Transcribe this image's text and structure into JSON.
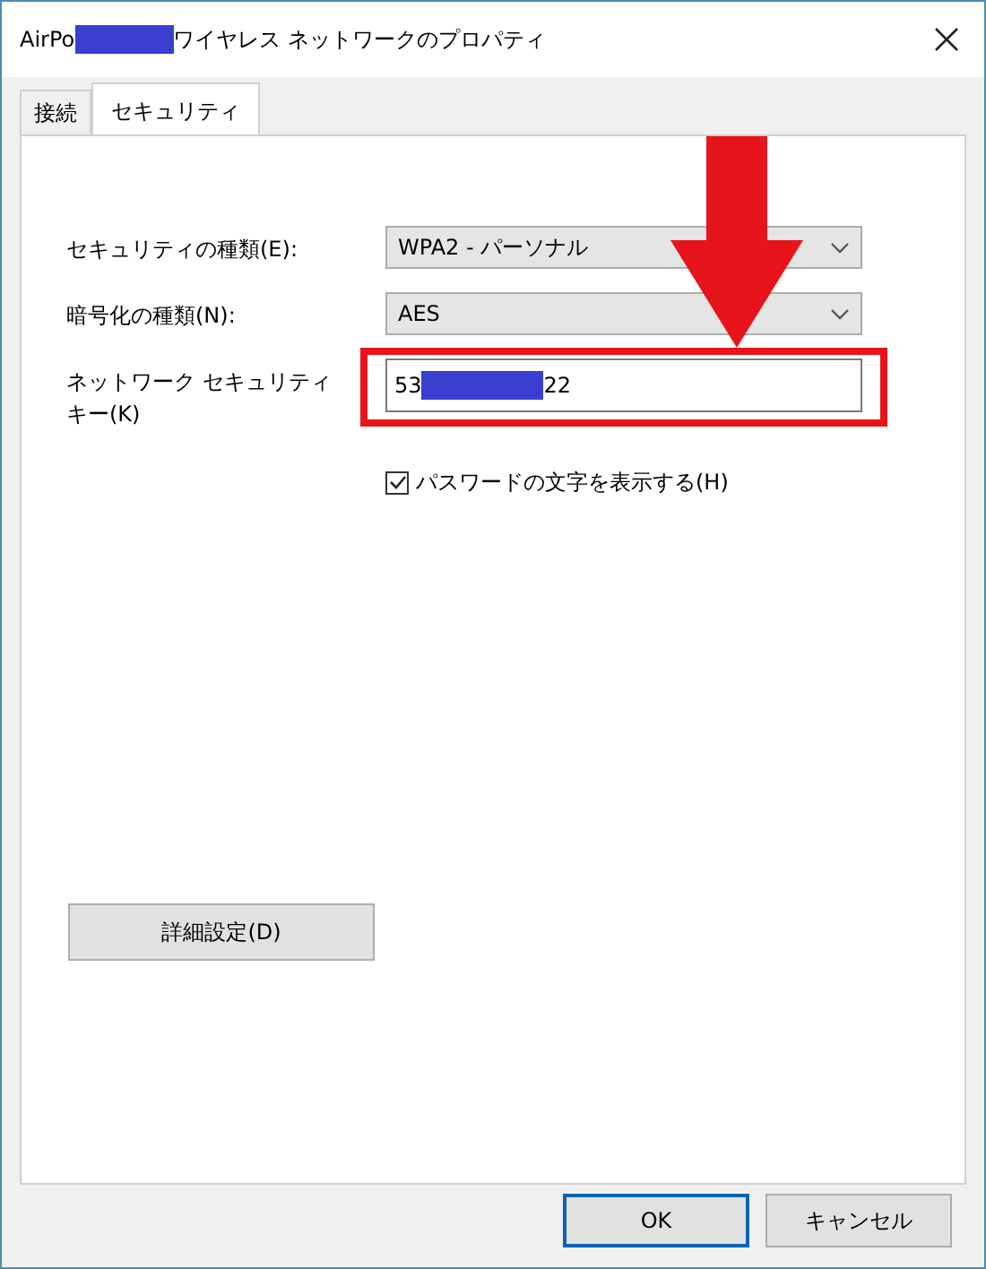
{
  "window": {
    "title_parts": [
      "AirPo",
      "ワイヤレス ネットワークのプロパティ"
    ],
    "title_redacted": true
  },
  "tabs": [
    {
      "label": "接続",
      "selected": false
    },
    {
      "label": "セキュリティ",
      "selected": true
    }
  ],
  "fields": [
    {
      "kind": "combo",
      "label": "セキュリティの種類(E):",
      "value": "WPA2 - パーソナル"
    },
    {
      "kind": "combo",
      "label": "暗号化の種類(N):",
      "value": "AES"
    },
    {
      "kind": "text",
      "label": "ネットワーク セキュリティキー(K)",
      "value_parts": [
        "53",
        "22"
      ],
      "redacted": true,
      "highlighted": true
    }
  ],
  "show_password": {
    "label": "パスワードの文字を表示する(H)",
    "checked": true
  },
  "advanced_button": "詳細設定(D)",
  "annotations": [
    {
      "kind": "arrow"
    }
  ],
  "buttons": [
    {
      "label": "OK",
      "selected": true
    },
    {
      "label": "キャンセル",
      "selected": false
    }
  ]
}
